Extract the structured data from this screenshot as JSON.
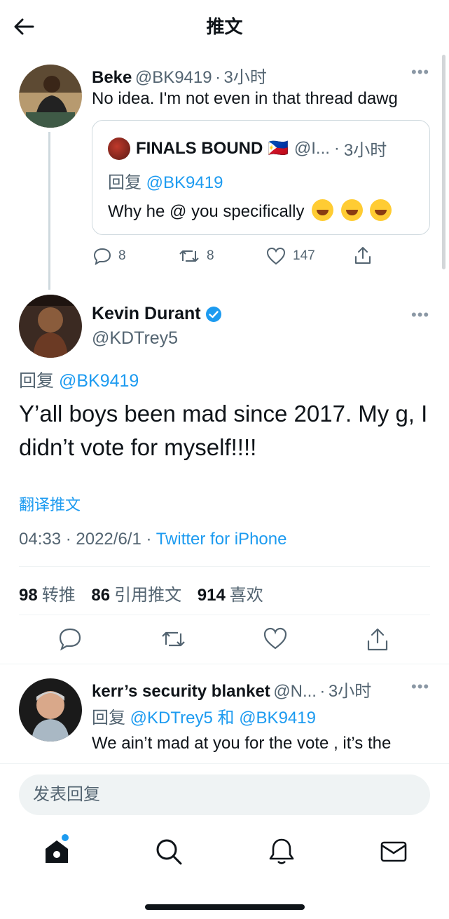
{
  "header": {
    "title": "推文",
    "back_icon": "arrow-left-icon"
  },
  "parent_tweet": {
    "name": "Beke",
    "handle": "@BK9419",
    "sep": "·",
    "time": "3小时",
    "text": "No idea. I'm not even in that thread dawg",
    "quote": {
      "name": "FINALS BOUND 🇵🇭",
      "handle": "@I...",
      "sep": "·",
      "time": "3小时",
      "reply_prefix": "回复",
      "reply_to": "@BK9419",
      "text": "Why he @ you specifically"
    },
    "actions": {
      "replies": "8",
      "retweets": "8",
      "likes": "147"
    }
  },
  "main_tweet": {
    "name": "Kevin Durant",
    "verified": true,
    "handle": "@KDTrey5",
    "reply_prefix": "回复",
    "reply_to": "@BK9419",
    "text": "Y’all boys been mad since 2017. My g, I didn’t vote for myself!!!!",
    "translate": "翻译推文",
    "time": "04:33 · 2022/6/1 · ",
    "source": "Twitter for iPhone",
    "stats": {
      "retweets": "98",
      "retweets_label": "转推",
      "quotes": "86",
      "quotes_label": "引用推文",
      "likes": "914",
      "likes_label": "喜欢"
    }
  },
  "reply_tweet": {
    "name": "kerr’s security blanket",
    "handle": "@N...",
    "sep": "·",
    "time": "3小时",
    "reply_prefix": "回复",
    "reply_to_1": "@KDTrey5",
    "reply_and": "和",
    "reply_to_2": "@BK9419",
    "text": "We ain’t mad at you for the vote , it’s the"
  },
  "composer": {
    "placeholder": "发表回复"
  },
  "colors": {
    "accent": "#1d9bf0",
    "text": "#0f1419",
    "secondary": "#536471",
    "border": "#cfd9de"
  },
  "tabbar": {
    "items": [
      "home-icon",
      "search-icon",
      "bell-icon",
      "mail-icon"
    ]
  }
}
